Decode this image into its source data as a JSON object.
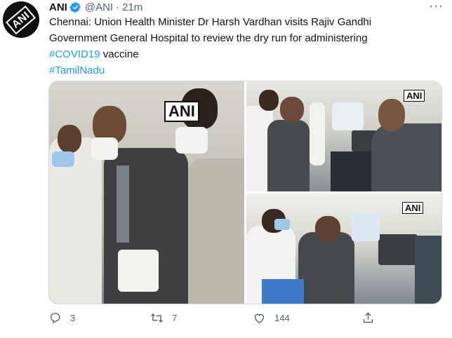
{
  "tweet": {
    "author_name": "ANI",
    "author_handle": "@ANI",
    "separator": "·",
    "timestamp": "21m",
    "avatar_text": "ANI",
    "text_line1": "Chennai: Union Health Minister Dr Harsh Vardhan visits Rajiv Gandhi",
    "text_line2": "Government General Hospital to review the dry run for administering",
    "hashtag_covid": "#COVID19",
    "text_after_hashtag": " vaccine",
    "hashtag_tamilnadu": "#TamilNadu",
    "more_label": "···"
  },
  "media": {
    "watermark_main": "ANI",
    "watermark_top": "ANI",
    "watermark_bottom": "ANI"
  },
  "actions": {
    "reply_count": "3",
    "retweet_count": "7",
    "like_count": "144"
  },
  "colors": {
    "text": "#0f1419",
    "secondary": "#536471",
    "link": "#1d9bf0",
    "border": "#cfd9de"
  },
  "icons": [
    "verified-badge-icon",
    "more-icon",
    "reply-icon",
    "retweet-icon",
    "like-icon",
    "share-icon"
  ]
}
